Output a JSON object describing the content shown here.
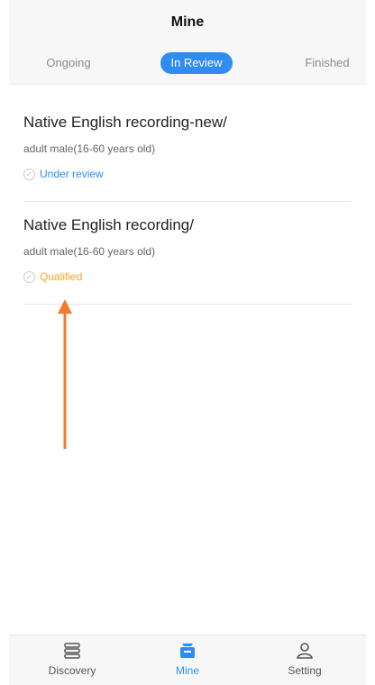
{
  "header": {
    "title": "Mine",
    "tabs": [
      {
        "label": "Ongoing"
      },
      {
        "label": "In Review"
      },
      {
        "label": "Finished"
      }
    ]
  },
  "items": [
    {
      "title": "Native English recording-new/",
      "subtitle": "adult male(16-60 years old)",
      "status": "Under review",
      "status_color": "#2f8cf0"
    },
    {
      "title": "Native English recording/",
      "subtitle": "adult male(16-60 years old)",
      "status": "Qualified",
      "status_color": "#f5a623"
    }
  ],
  "bottom_nav": {
    "items": [
      {
        "label": "Discovery",
        "icon": "discovery-icon"
      },
      {
        "label": "Mine",
        "icon": "mine-icon"
      },
      {
        "label": "Setting",
        "icon": "setting-icon"
      }
    ]
  },
  "colors": {
    "accent": "#2f8cf0",
    "annotation_arrow": "#f27a2e"
  }
}
